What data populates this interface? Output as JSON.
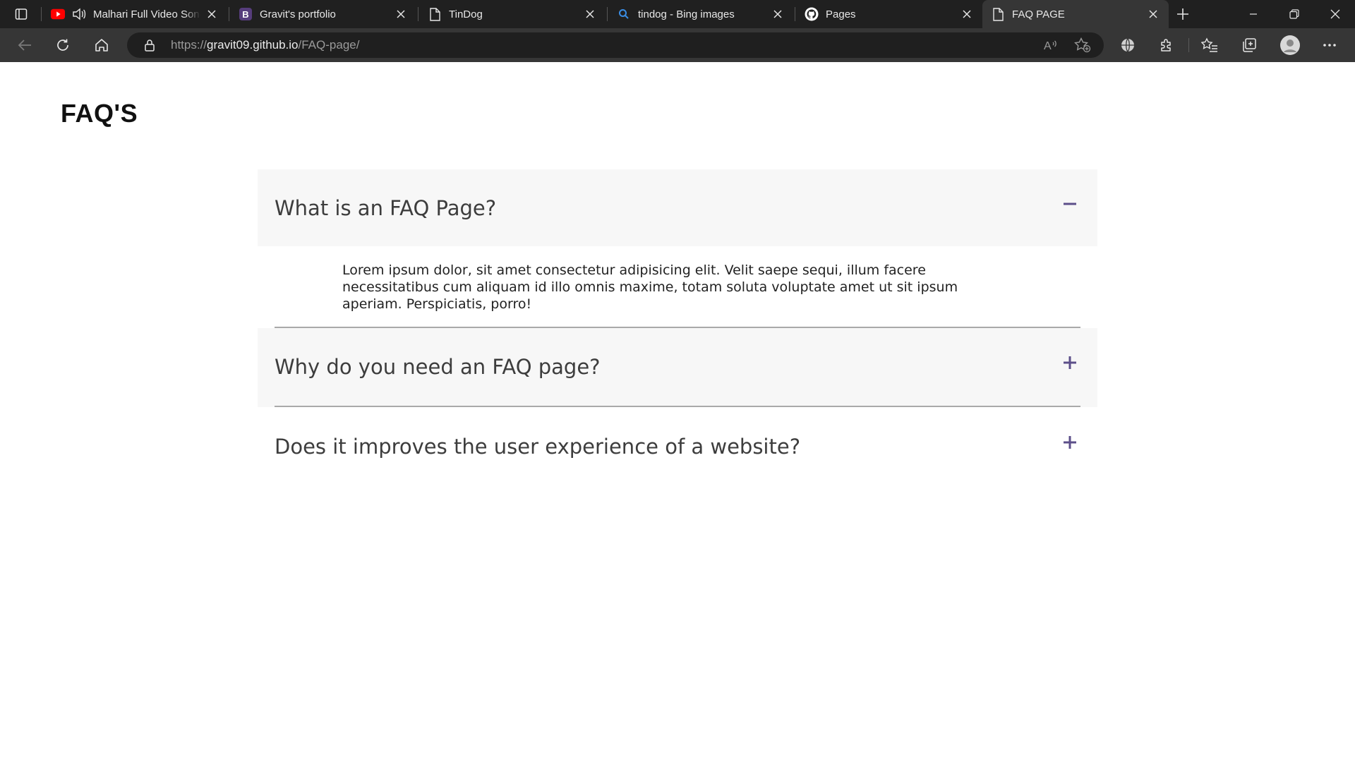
{
  "browser": {
    "tabs": [
      {
        "title": "Malhari Full Video Song",
        "favicon": "youtube-icon",
        "audio": "speaker-icon"
      },
      {
        "title": "Gravit's portfolio",
        "favicon": "bootstrap-icon",
        "favicon_text": "B"
      },
      {
        "title": "TinDog",
        "favicon": "page-icon"
      },
      {
        "title": "tindog - Bing images",
        "favicon": "search-icon"
      },
      {
        "title": "Pages",
        "favicon": "github-icon"
      },
      {
        "title": "FAQ PAGE",
        "favicon": "page-icon",
        "active": true
      }
    ],
    "url": {
      "scheme": "https://",
      "host": "gravit09.github.io",
      "path": "/FAQ-page/"
    },
    "colors": {
      "tabbar_bg": "#202020",
      "toolbar_bg": "#363636",
      "address_bg": "#1f1f1f"
    }
  },
  "page": {
    "heading": "FAQ'S",
    "faqs": [
      {
        "question": "What is an FAQ Page?",
        "expanded": true,
        "toggle": "minus-icon",
        "answer": "Lorem ipsum dolor, sit amet consectetur adipisicing elit. Velit saepe sequi, illum facere necessitatibus cum aliquam id illo omnis maxime, totam soluta voluptate amet ut sit ipsum aperiam. Perspiciatis, porro!"
      },
      {
        "question": "Why do you need an FAQ page?",
        "expanded": false,
        "toggle": "plus-icon"
      },
      {
        "question": "Does it improves the user experience of a website?",
        "expanded": false,
        "toggle": "plus-icon"
      }
    ],
    "colors": {
      "accent": "#5c4f8a",
      "question_bg": "#f7f7f7",
      "question_text": "#3d3d3d"
    }
  }
}
